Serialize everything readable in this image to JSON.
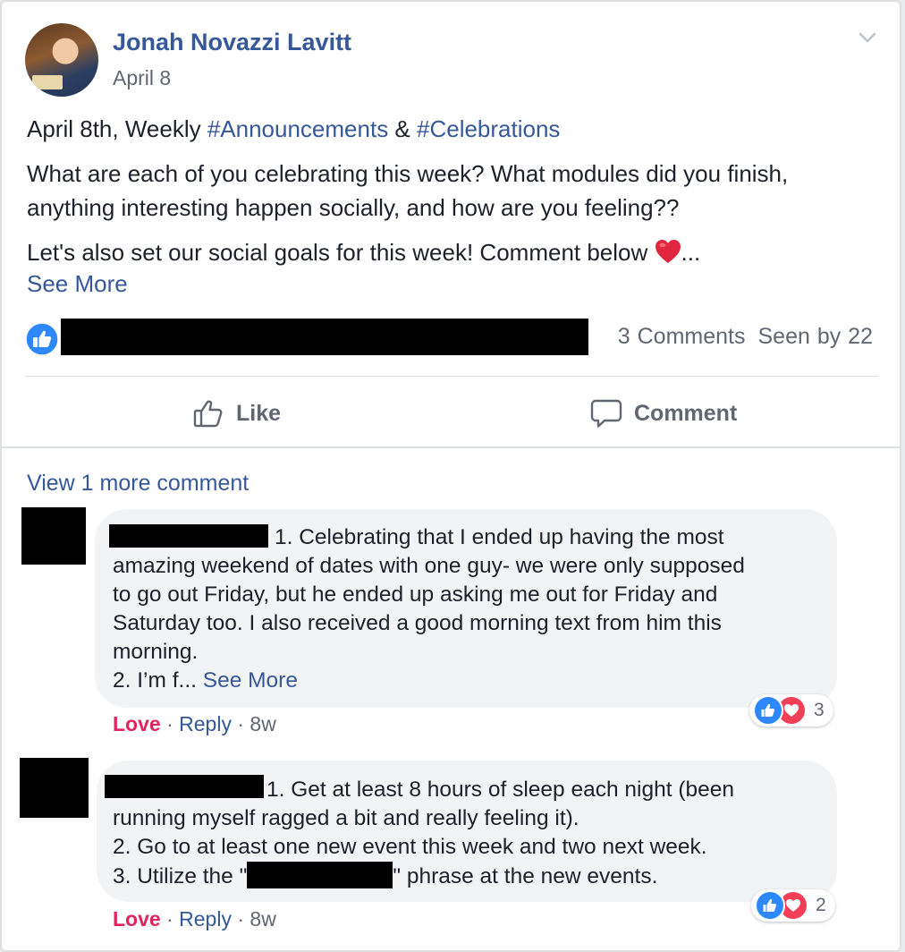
{
  "post": {
    "author": "Jonah Novazzi Lavitt",
    "date": "April 8",
    "line1_prefix": "April 8th, Weekly ",
    "hashtag1": "#Announcements",
    "amp": " & ",
    "hashtag2": "#Celebrations",
    "line2": "What are each of you celebrating this week? What modules did you finish,",
    "line3": "anything interesting happen socially, and how are you feeling??",
    "line4": "Let's also set our social goals for this week! Comment below ",
    "ellipsis": "...",
    "see_more": "See More",
    "comments_count": "3 Comments",
    "seen_by": "Seen by 22"
  },
  "actions": {
    "like": "Like",
    "comment": "Comment"
  },
  "view_more": "View 1 more comment",
  "comments": [
    {
      "lines": [
        "1. Celebrating that I ended up having the most",
        "amazing weekend of dates with one guy- we were only supposed",
        "to go out Friday, but he ended up asking me out for Friday and",
        "Saturday too. I also received a good morning text from him this",
        "morning."
      ],
      "last_line_prefix": "2. I’m f... ",
      "see_more": "See More",
      "love": "Love",
      "reply": "Reply",
      "sep": " · ",
      "time": "8w",
      "reaction_count": "3"
    },
    {
      "lines": [
        "1. Get at least 8 hours of sleep each night (been",
        "running myself ragged a bit and really feeling it).",
        "2. Go to at least one new event this week and two next week."
      ],
      "line4_prefix": "3. Utilize the \"",
      "line4_suffix": "\" phrase at the new events.",
      "love": "Love",
      "reply": "Reply",
      "sep": " · ",
      "time": "8w",
      "reaction_count": "2"
    }
  ],
  "icons": {
    "menu": "chevron-down-icon",
    "like_badge": "thumbs-up-icon",
    "like_action": "thumbs-up-outline-icon",
    "comment_action": "speech-bubble-icon",
    "heart": "red-heart-icon",
    "reactions": [
      "thumbs-up-icon",
      "heart-icon"
    ]
  },
  "colors": {
    "link": "#365899",
    "love": "#e0245e",
    "like_blue": "#2d88ff",
    "heart_red": "#f33e58",
    "meta_gray": "#606770"
  }
}
